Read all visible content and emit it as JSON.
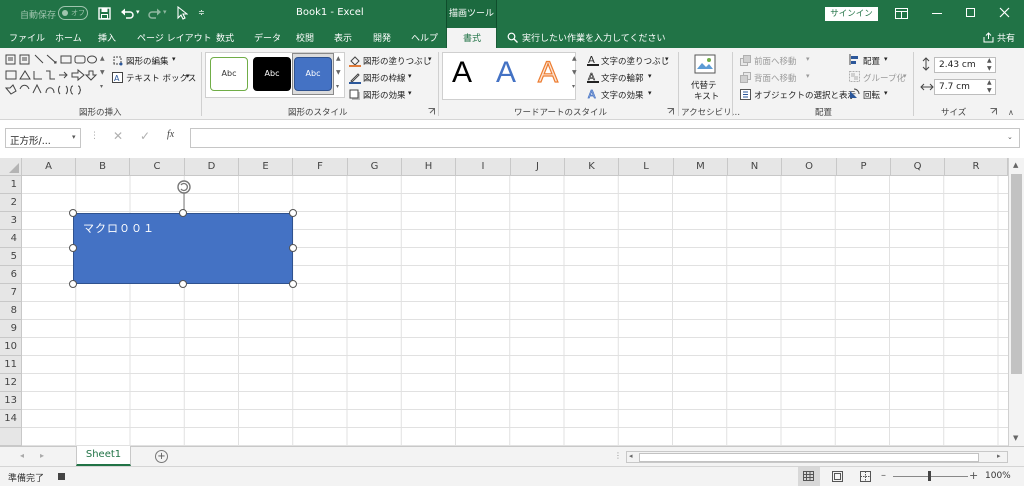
{
  "titlebar": {
    "autosave_label": "自動保存",
    "autosave_state": "オフ",
    "doc_title": "Book1  -  Excel",
    "context_group": "描画ツール",
    "signin": "サインイン"
  },
  "tabs": [
    "ファイル",
    "ホーム",
    "挿入",
    "ページ レイアウト",
    "数式",
    "データ",
    "校閲",
    "表示",
    "開発",
    "ヘルプ",
    "書式"
  ],
  "active_tab": "書式",
  "tell_me": "実行したい作業を入力してください",
  "share": "共有",
  "ribbon": {
    "insert_shapes": {
      "edit_shape": "図形の編集",
      "text_box": "テキスト ボックス",
      "label": "図形の挿入"
    },
    "shape_styles": {
      "samples": [
        "Abc",
        "Abc",
        "Abc"
      ],
      "fill": "図形の塗りつぶし",
      "outline": "図形の枠線",
      "effects": "図形の効果",
      "label": "図形のスタイル"
    },
    "wordart": {
      "samples": [
        "A",
        "A",
        "A"
      ],
      "text_fill": "文字の塗りつぶし",
      "text_outline": "文字の輪郭",
      "text_effects": "文字の効果",
      "label": "ワードアートのスタイル"
    },
    "accessibility": {
      "alt_text_line1": "代替テ",
      "alt_text_line2": "キスト",
      "label": "アクセシビリ…"
    },
    "arrange": {
      "bring_forward": "前面へ移動",
      "send_backward": "背面へ移動",
      "selection_pane": "オブジェクトの選択と表示",
      "align": "配置",
      "group": "グループ化",
      "rotate": "回転",
      "label": "配置"
    },
    "size": {
      "height": "2.43 cm",
      "width": "7.7 cm",
      "label": "サイズ"
    }
  },
  "formula_bar": {
    "name_box": "正方形/...",
    "fx": "fx",
    "value": ""
  },
  "columns": [
    "A",
    "B",
    "C",
    "D",
    "E",
    "F",
    "G",
    "H",
    "I",
    "J",
    "K",
    "L",
    "M",
    "N",
    "O",
    "P",
    "Q",
    "R"
  ],
  "rows": [
    "1",
    "2",
    "3",
    "4",
    "5",
    "6",
    "7",
    "8",
    "9",
    "10",
    "11",
    "12",
    "13",
    "14"
  ],
  "shape": {
    "text": "マクロ００１",
    "fill": "#4472c4"
  },
  "sheet_tabs": [
    "Sheet1"
  ],
  "status": {
    "ready": "準備完了",
    "zoom": "100%"
  },
  "colors": {
    "excel_green": "#217346",
    "shape_blue": "#4472c4"
  }
}
